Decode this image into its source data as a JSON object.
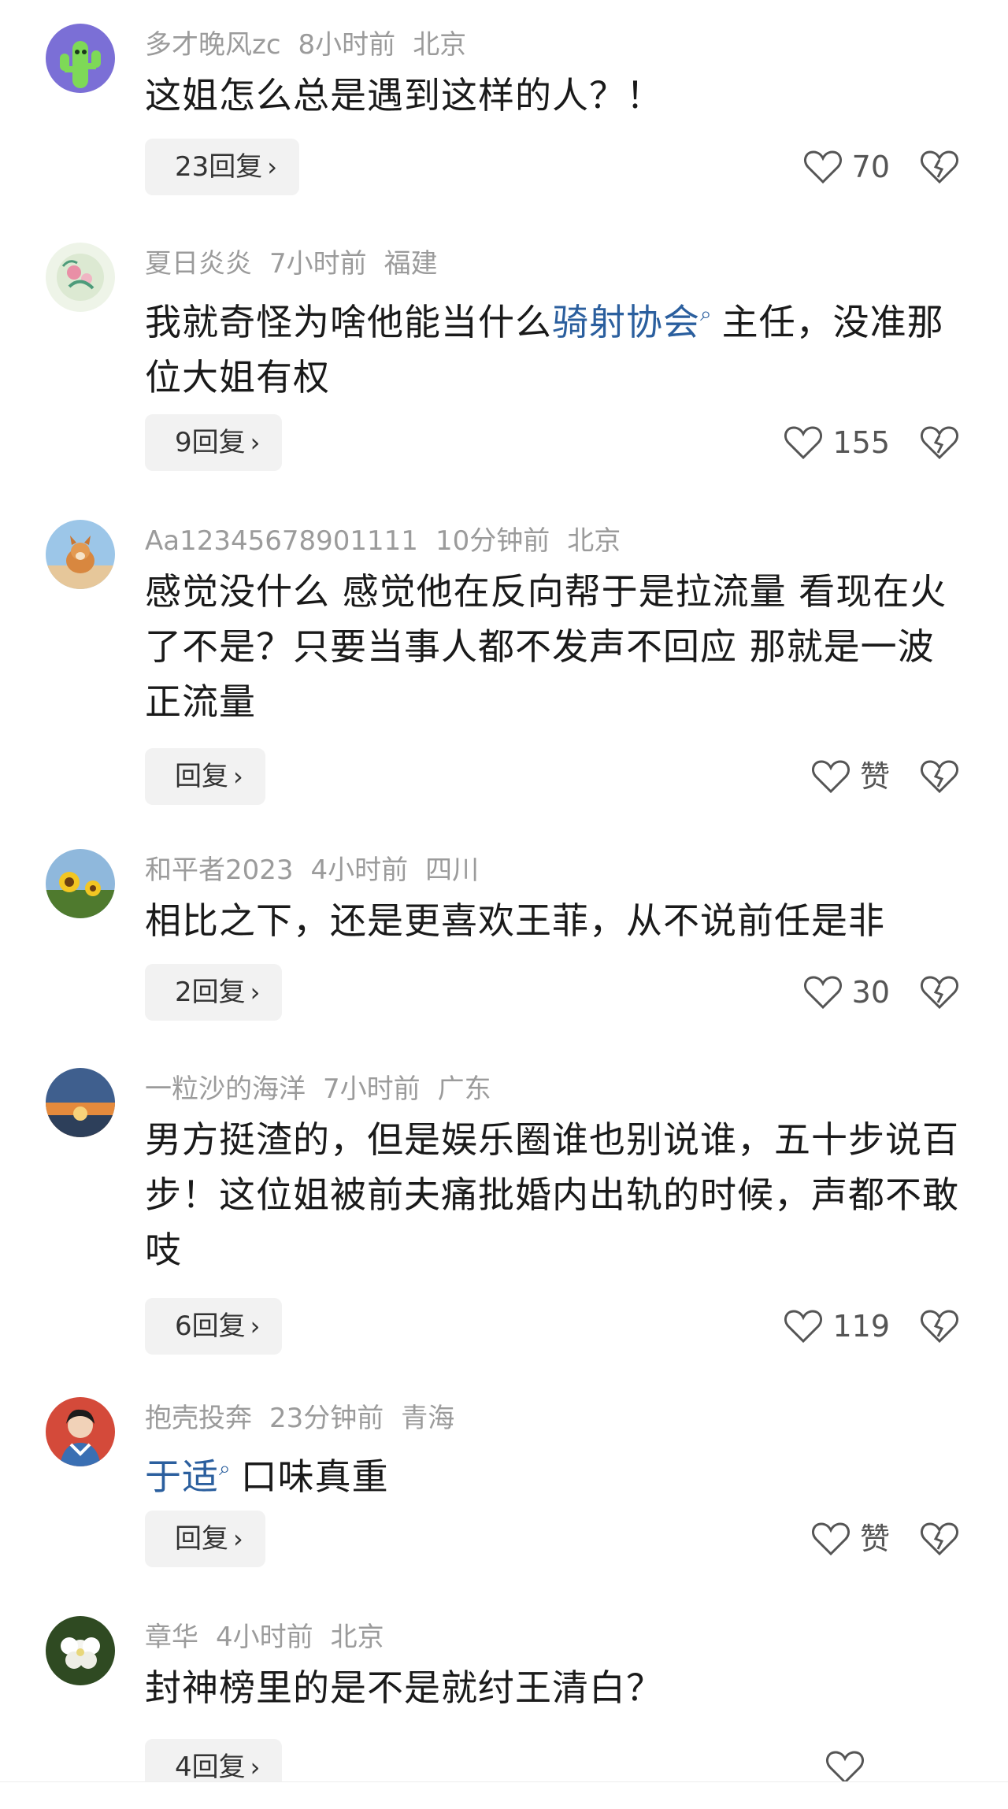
{
  "comments": [
    {
      "username": "多才晚风zc",
      "time": "8小时前",
      "location": "北京",
      "text_before": "这姐怎么总是遇到这样的人？！",
      "highlight": "",
      "text_after": "",
      "reply_label": "23回复",
      "like_label": "70"
    },
    {
      "username": "夏日炎炎",
      "time": "7小时前",
      "location": "福建",
      "text_before": "我就奇怪为啥他能当什么",
      "highlight": "骑射协会",
      "text_after": "主任，没准那位大姐有权",
      "reply_label": "9回复",
      "like_label": "155"
    },
    {
      "username": "Aa12345678901111",
      "time": "10分钟前",
      "location": "北京",
      "text_before": "感觉没什么 感觉他在反向帮于是拉流量 看现在火了不是？只要当事人都不发声不回应 那就是一波正流量",
      "highlight": "",
      "text_after": "",
      "reply_label": "回复",
      "like_label": "赞"
    },
    {
      "username": "和平者2023",
      "time": "4小时前",
      "location": "四川",
      "text_before": "相比之下，还是更喜欢王菲，从不说前任是非",
      "highlight": "",
      "text_after": "",
      "reply_label": "2回复",
      "like_label": "30"
    },
    {
      "username": "一粒沙的海洋",
      "time": "7小时前",
      "location": "广东",
      "text_before": "男方挺渣的，但是娱乐圈谁也别说谁，五十步说百步！这位姐被前夫痛批婚内出轨的时候，声都不敢吱",
      "highlight": "",
      "text_after": "",
      "reply_label": "6回复",
      "like_label": "119"
    },
    {
      "username": "抱壳投奔",
      "time": "23分钟前",
      "location": "青海",
      "text_before": "",
      "highlight": "于适",
      "text_after": "口味真重",
      "reply_label": "回复",
      "like_label": "赞"
    },
    {
      "username": "章华",
      "time": "4小时前",
      "location": "北京",
      "text_before": "封神榜里的是不是就纣王清白？",
      "highlight": "",
      "text_after": "",
      "reply_label": "4回复",
      "like_label": ""
    }
  ],
  "icons": {
    "search_mark": "⌕",
    "chevron": "›"
  },
  "colors": {
    "link": "#2b5f9e",
    "meta": "#9b9b9b",
    "reply_bg": "#f2f2f2"
  }
}
